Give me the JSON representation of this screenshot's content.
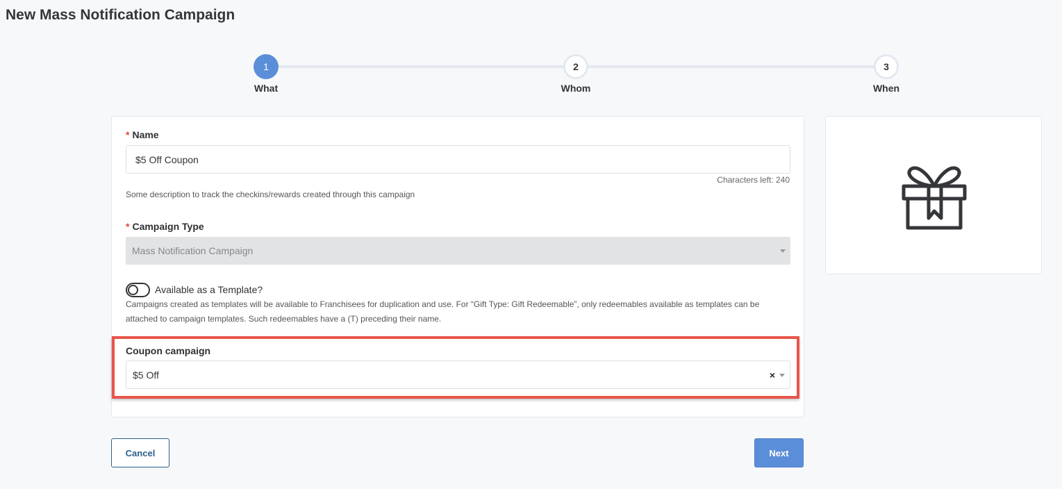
{
  "page": {
    "title": "New Mass Notification Campaign"
  },
  "stepper": {
    "steps": [
      {
        "number": "1",
        "label": "What"
      },
      {
        "number": "2",
        "label": "Whom"
      },
      {
        "number": "3",
        "label": "When"
      }
    ],
    "active_step": 1
  },
  "form": {
    "name": {
      "label": "Name",
      "required_mark": "*",
      "value": "$5 Off Coupon",
      "chars_left": "Characters left: 240",
      "help": "Some description to track the checkins/rewards created through this campaign"
    },
    "campaign_type": {
      "label": "Campaign Type",
      "required_mark": "*",
      "value": "Mass Notification Campaign"
    },
    "template": {
      "label": "Available as a Template?",
      "enabled": false,
      "help_line1": "Campaigns created as templates will be available to Franchisees for duplication and use. For “Gift Type: Gift Redeemable”, only redeemables available as templates can be",
      "help_line2": "attached to campaign templates. Such redeemables have a (T) preceding their name."
    },
    "coupon": {
      "label": "Coupon campaign",
      "value": "$5 Off",
      "clear": "×"
    }
  },
  "preview": {
    "icon": "gift-icon"
  },
  "buttons": {
    "cancel": "Cancel",
    "next": "Next"
  },
  "colors": {
    "accent": "#5b8ed9",
    "highlight": "#e8554a",
    "required": "#e0473b"
  }
}
